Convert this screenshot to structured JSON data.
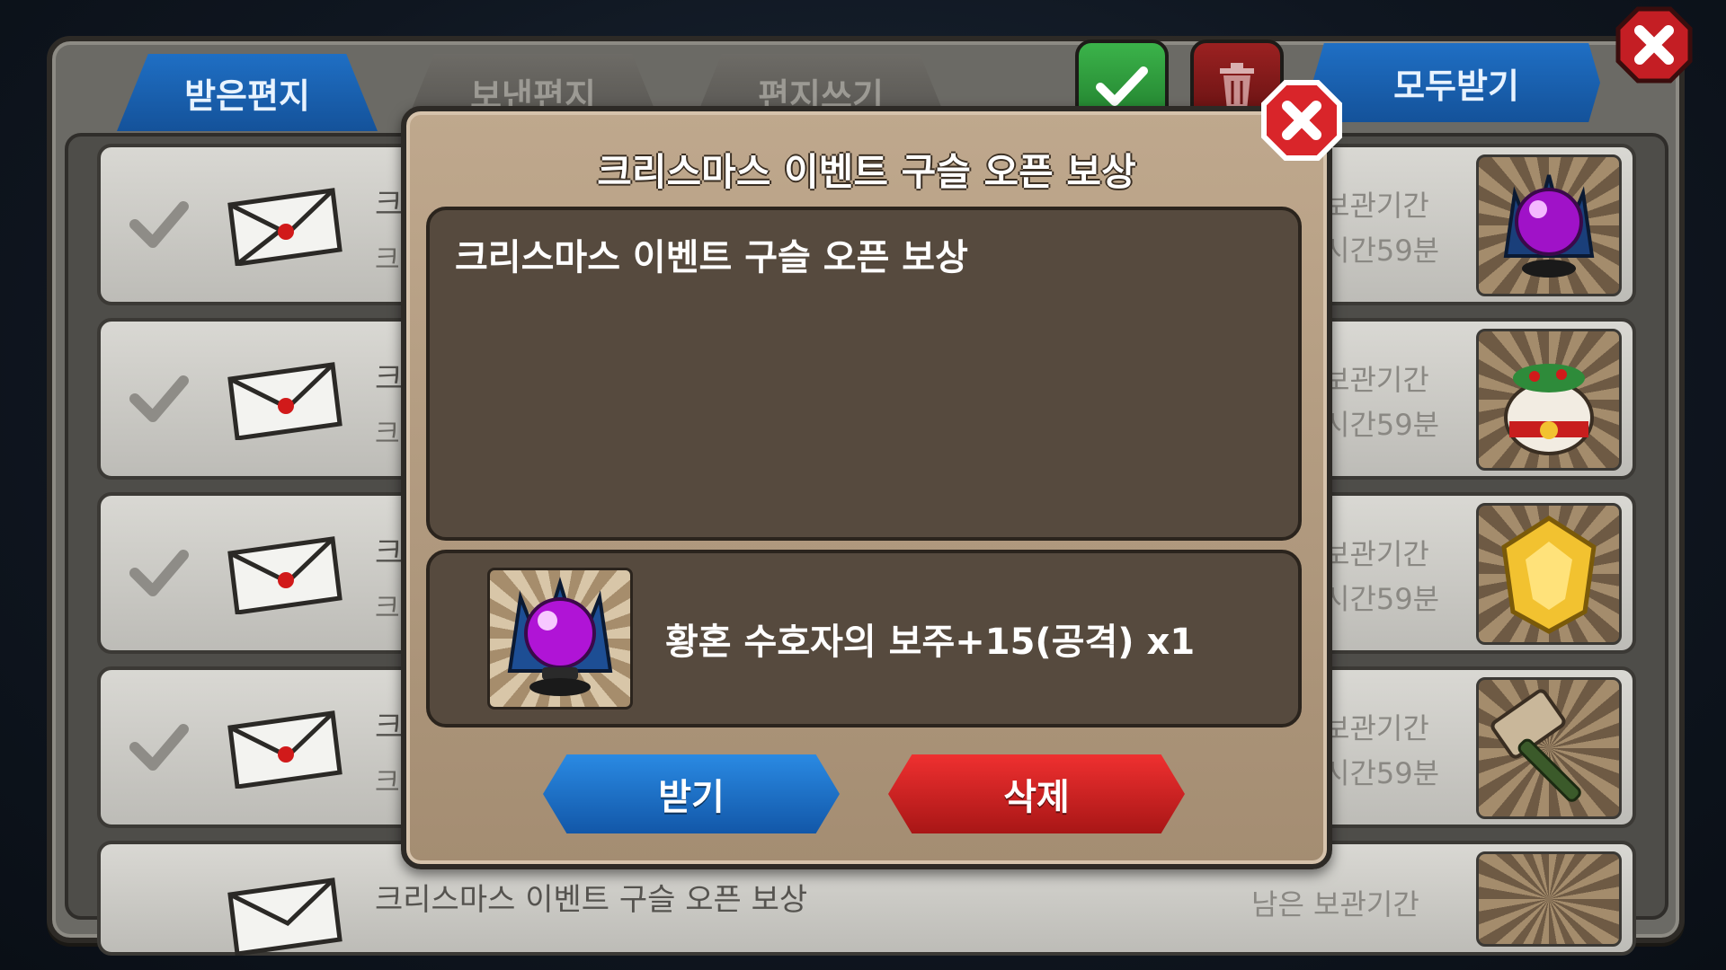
{
  "tabs": {
    "received": "받은편지",
    "sent": "보낸편지",
    "compose": "편지쓰기"
  },
  "toolbar": {
    "receive_all": "모두받기",
    "check_icon": "check-icon",
    "trash_icon": "trash-icon",
    "close_icon": "close-icon"
  },
  "mail_list": [
    {
      "title": "크",
      "subtitle": "크",
      "keep_label": "보관기간",
      "time_left": "시간59분",
      "item_icon": "purple-orb-icon"
    },
    {
      "title": "크",
      "subtitle": "크",
      "keep_label": "보관기간",
      "time_left": "시간59분",
      "item_icon": "christmas-pouch-icon"
    },
    {
      "title": "크",
      "subtitle": "크",
      "keep_label": "보관기간",
      "time_left": "시간59분",
      "item_icon": "gold-gem-icon"
    },
    {
      "title": "크",
      "subtitle": "크",
      "keep_label": "보관기간",
      "time_left": "시간59분",
      "item_icon": "hammer-icon"
    },
    {
      "title": "크리스마스 이벤트 구슬 오픈 보상",
      "subtitle": "",
      "keep_label": "남은 보관기간",
      "time_left": "",
      "item_icon": "gold-item-icon"
    }
  ],
  "dialog": {
    "title": "크리스마스 이벤트 구슬 오픈 보상",
    "message": "크리스마스 이벤트 구슬 오픈 보상",
    "reward": {
      "icon": "purple-orb-icon",
      "text": "황혼 수호자의 보주+15(공격) x1"
    },
    "receive_label": "받기",
    "delete_label": "삭제"
  },
  "colors": {
    "tab_active": "#1f6fc4",
    "receive_button": "#2a8ae3",
    "delete_button": "#ef3030",
    "check_button": "#3bb34a",
    "close_red": "#d9252a"
  }
}
